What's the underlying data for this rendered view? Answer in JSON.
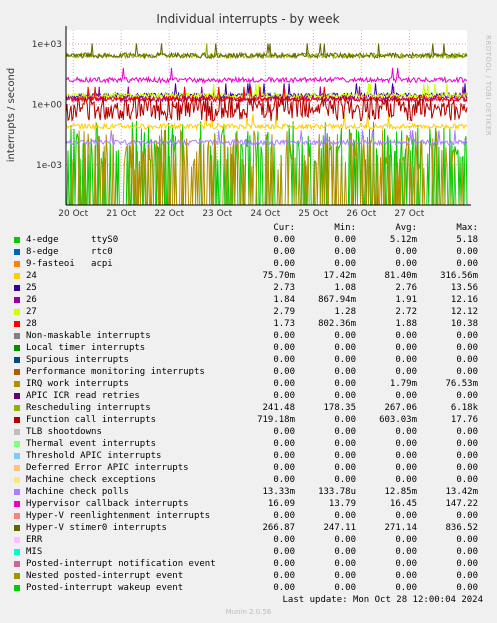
{
  "chart_data": {
    "type": "line",
    "title": "Individual interrupts - by week",
    "ylabel": "interrupts / second",
    "yscale": "log",
    "ylim": [
      1e-05,
      5000
    ],
    "y_ticks": [
      {
        "value": 1000,
        "label": "1e+03"
      },
      {
        "value": 1,
        "label": "1e+00"
      },
      {
        "value": 0.001,
        "label": "1e-03"
      }
    ],
    "x_ticks": [
      "20 Oct",
      "21 Oct",
      "22 Oct",
      "23 Oct",
      "24 Oct",
      "25 Oct",
      "26 Oct",
      "27 Oct"
    ],
    "grid": true,
    "side_label": "RRDTOOL / TOBI OETIKER",
    "series": [
      {
        "name": "4-edge      ttyS0",
        "color": "#00cc00",
        "cur": "0.00",
        "min": "0.00",
        "avg": "5.12m",
        "max": "5.18"
      },
      {
        "name": "8-edge      rtc0",
        "color": "#0066b3",
        "cur": "0.00",
        "min": "0.00",
        "avg": "0.00",
        "max": "0.00"
      },
      {
        "name": "9-fasteoi   acpi",
        "color": "#ff8000",
        "cur": "0.00",
        "min": "0.00",
        "avg": "0.00",
        "max": "0.00"
      },
      {
        "name": "24",
        "color": "#ffcc00",
        "cur": "75.70m",
        "min": "17.42m",
        "avg": "81.40m",
        "max": "316.56m"
      },
      {
        "name": "25",
        "color": "#330099",
        "cur": "2.73",
        "min": "1.08",
        "avg": "2.76",
        "max": "13.56"
      },
      {
        "name": "26",
        "color": "#990099",
        "cur": "1.84",
        "min": "867.94m",
        "avg": "1.91",
        "max": "12.16"
      },
      {
        "name": "27",
        "color": "#ccff00",
        "cur": "2.79",
        "min": "1.28",
        "avg": "2.72",
        "max": "12.12"
      },
      {
        "name": "28",
        "color": "#ff0000",
        "cur": "1.73",
        "min": "802.36m",
        "avg": "1.88",
        "max": "10.38"
      },
      {
        "name": "Non-maskable interrupts",
        "color": "#808080",
        "cur": "0.00",
        "min": "0.00",
        "avg": "0.00",
        "max": "0.00"
      },
      {
        "name": "Local timer interrupts",
        "color": "#008f00",
        "cur": "0.00",
        "min": "0.00",
        "avg": "0.00",
        "max": "0.00"
      },
      {
        "name": "Spurious interrupts",
        "color": "#00487d",
        "cur": "0.00",
        "min": "0.00",
        "avg": "0.00",
        "max": "0.00"
      },
      {
        "name": "Performance monitoring interrupts",
        "color": "#b35a00",
        "cur": "0.00",
        "min": "0.00",
        "avg": "0.00",
        "max": "0.00"
      },
      {
        "name": "IRQ work interrupts",
        "color": "#b38f00",
        "cur": "0.00",
        "min": "0.00",
        "avg": "1.79m",
        "max": "76.53m"
      },
      {
        "name": "APIC ICR read retries",
        "color": "#6b006b",
        "cur": "0.00",
        "min": "0.00",
        "avg": "0.00",
        "max": "0.00"
      },
      {
        "name": "Rescheduling interrupts",
        "color": "#8fb300",
        "cur": "241.48",
        "min": "178.35",
        "avg": "267.06",
        "max": "6.18k"
      },
      {
        "name": "Function call interrupts",
        "color": "#b30000",
        "cur": "719.18m",
        "min": "0.00",
        "avg": "603.03m",
        "max": "17.76"
      },
      {
        "name": "TLB shootdowns",
        "color": "#bebebe",
        "cur": "0.00",
        "min": "0.00",
        "avg": "0.00",
        "max": "0.00"
      },
      {
        "name": "Thermal event interrupts",
        "color": "#80ff80",
        "cur": "0.00",
        "min": "0.00",
        "avg": "0.00",
        "max": "0.00"
      },
      {
        "name": "Threshold APIC interrupts",
        "color": "#80c9ff",
        "cur": "0.00",
        "min": "0.00",
        "avg": "0.00",
        "max": "0.00"
      },
      {
        "name": "Deferred Error APIC interrupts",
        "color": "#ffc080",
        "cur": "0.00",
        "min": "0.00",
        "avg": "0.00",
        "max": "0.00"
      },
      {
        "name": "Machine check exceptions",
        "color": "#ffe680",
        "cur": "0.00",
        "min": "0.00",
        "avg": "0.00",
        "max": "0.00"
      },
      {
        "name": "Machine check polls",
        "color": "#aa80ff",
        "cur": "13.33m",
        "min": "133.78u",
        "avg": "12.85m",
        "max": "13.42m"
      },
      {
        "name": "Hypervisor callback interrupts",
        "color": "#ee00cc",
        "cur": "16.09",
        "min": "13.79",
        "avg": "16.45",
        "max": "147.22"
      },
      {
        "name": "Hyper-V reenlightenment interrupts",
        "color": "#ff8080",
        "cur": "0.00",
        "min": "0.00",
        "avg": "0.00",
        "max": "0.00"
      },
      {
        "name": "Hyper-V stimer0 interrupts",
        "color": "#666600",
        "cur": "266.87",
        "min": "247.11",
        "avg": "271.14",
        "max": "836.52"
      },
      {
        "name": "ERR",
        "color": "#ffbfff",
        "cur": "0.00",
        "min": "0.00",
        "avg": "0.00",
        "max": "0.00"
      },
      {
        "name": "MIS",
        "color": "#00ffcc",
        "cur": "0.00",
        "min": "0.00",
        "avg": "0.00",
        "max": "0.00"
      },
      {
        "name": "Posted-interrupt notification event",
        "color": "#cc6699",
        "cur": "0.00",
        "min": "0.00",
        "avg": "0.00",
        "max": "0.00"
      },
      {
        "name": "Nested posted-interrupt event",
        "color": "#999900",
        "cur": "0.00",
        "min": "0.00",
        "avg": "0.00",
        "max": "0.00"
      },
      {
        "name": "Posted-interrupt wakeup event",
        "color": "#00cc00",
        "cur": "0.00",
        "min": "0.00",
        "avg": "0.00",
        "max": "0.00"
      }
    ]
  },
  "legend": {
    "header": {
      "cur": "Cur:",
      "min": "Min:",
      "avg": "Avg:",
      "max": "Max:"
    }
  },
  "footer": {
    "last_update": "Last update: Mon Oct 28 12:00:04 2024",
    "munin": "Munin 2.0.56"
  }
}
